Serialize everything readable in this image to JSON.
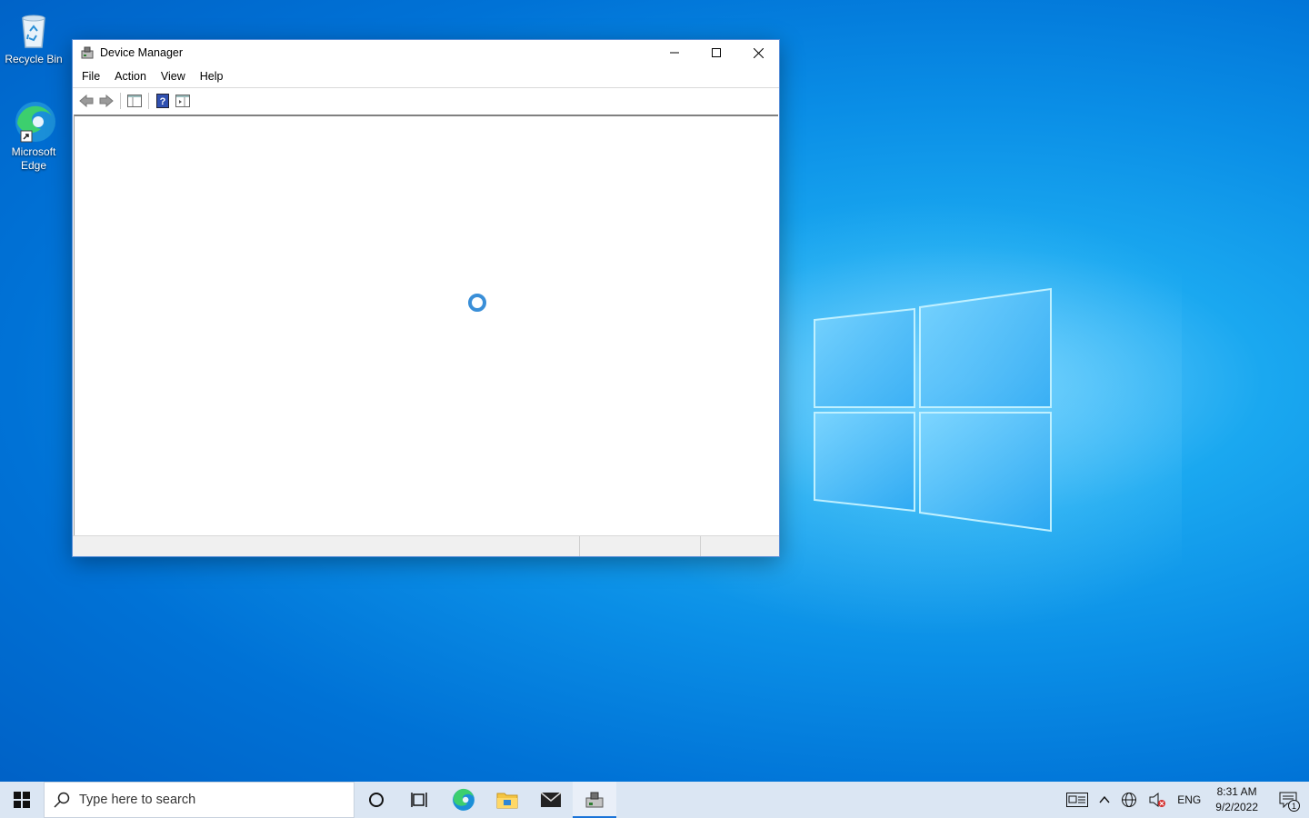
{
  "desktop": {
    "icons": [
      {
        "label": "Recycle Bin",
        "icon": "recycle-bin-icon"
      },
      {
        "label": "Microsoft Edge",
        "icon": "edge-icon"
      }
    ]
  },
  "window": {
    "title": "Device Manager",
    "menu": [
      "File",
      "Action",
      "View",
      "Help"
    ],
    "toolbar": [
      "back-icon",
      "forward-icon",
      "show-hide-console-tree-icon",
      "help-icon",
      "properties-pane-icon"
    ],
    "state": "loading"
  },
  "taskbar": {
    "search_placeholder": "Type here to search",
    "apps": [
      "cortana-icon",
      "task-view-icon",
      "edge-icon",
      "file-explorer-icon",
      "mail-icon",
      "device-manager-icon"
    ],
    "tray": {
      "language": "ENG",
      "time": "8:31 AM",
      "date": "9/2/2022",
      "notification_count": "1"
    }
  },
  "colors": {
    "accent": "#1a73d8",
    "spinner": "#3a8fd8",
    "taskbar": "#dbe6f3"
  }
}
